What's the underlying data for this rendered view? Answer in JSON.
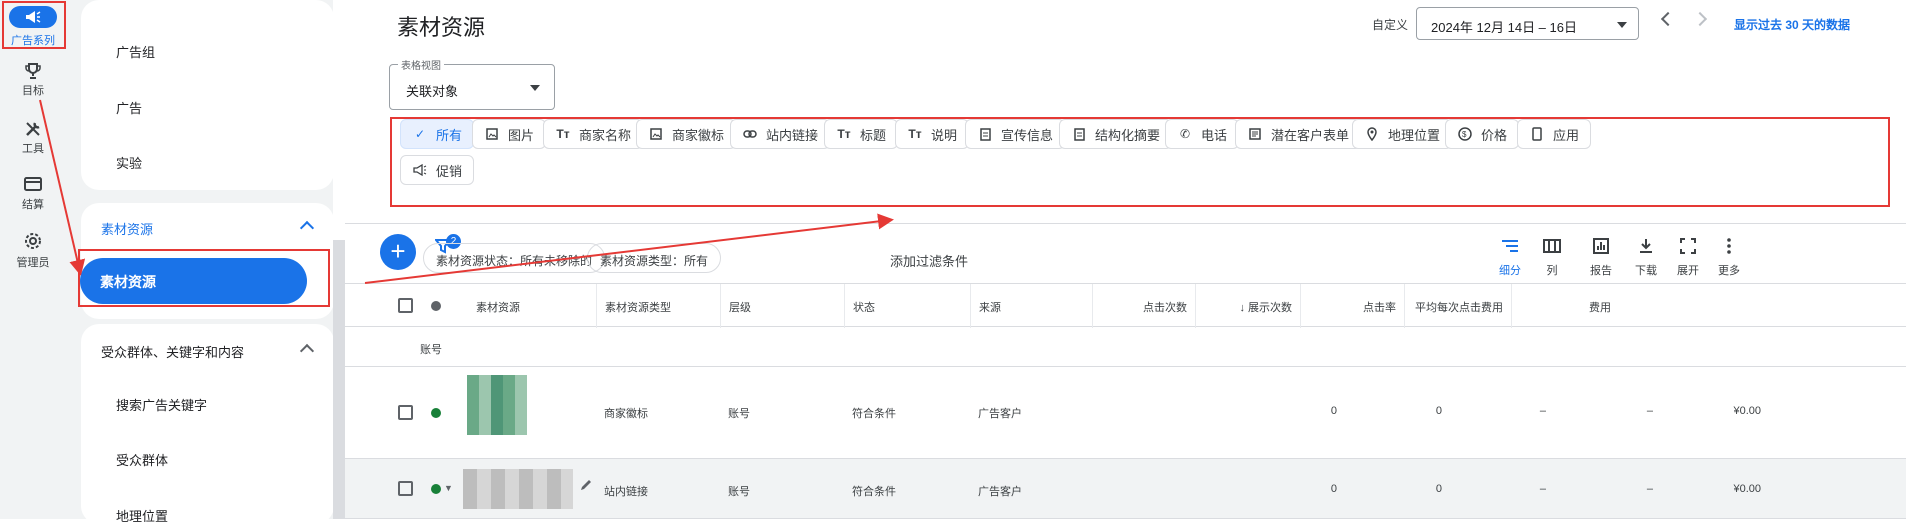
{
  "rail": [
    {
      "label": "广告系列",
      "icon": "megaphone-icon"
    },
    {
      "label": "目标",
      "icon": "trophy-icon"
    },
    {
      "label": "工具",
      "icon": "tools-icon"
    },
    {
      "label": "结算",
      "icon": "credit-card-icon"
    },
    {
      "label": "管理员",
      "icon": "gear-icon"
    }
  ],
  "sidebar": {
    "top_items": [
      "广告组",
      "广告",
      "实验"
    ],
    "assets_section": "素材资源",
    "assets_selected": "素材资源",
    "audience_section": "受众群体、关键字和内容",
    "audience_items": [
      "搜索广告关键字",
      "受众群体",
      "地理位置"
    ]
  },
  "header": {
    "title": "素材资源",
    "date_prefix": "自定义",
    "date_range": "2024年 12月 14日 – 16日",
    "show_30": "显示过去 30 天的数据"
  },
  "view_select": {
    "legend": "表格视图",
    "value": "关联对象"
  },
  "asset_types": [
    {
      "label": "所有",
      "icon": "check-icon",
      "selected": true
    },
    {
      "label": "图片",
      "icon": "image-icon"
    },
    {
      "label": "商家名称",
      "icon": "text-icon"
    },
    {
      "label": "商家徽标",
      "icon": "image-icon"
    },
    {
      "label": "站内链接",
      "icon": "link-icon"
    },
    {
      "label": "标题",
      "icon": "text-icon"
    },
    {
      "label": "说明",
      "icon": "text-icon"
    },
    {
      "label": "宣传信息",
      "icon": "document-icon"
    },
    {
      "label": "结构化摘要",
      "icon": "document-icon"
    },
    {
      "label": "电话",
      "icon": "phone-icon"
    },
    {
      "label": "潜在客户表单",
      "icon": "form-icon"
    },
    {
      "label": "地理位置",
      "icon": "location-pin-icon"
    },
    {
      "label": "价格",
      "icon": "price-icon"
    },
    {
      "label": "应用",
      "icon": "mobile-icon"
    },
    {
      "label": "促销",
      "icon": "megaphone-icon"
    }
  ],
  "filters": {
    "badge": "2",
    "chips": [
      "素材资源状态：所有未移除的",
      "素材资源类型：所有"
    ],
    "add": "添加过滤条件"
  },
  "toolbar": [
    "细分",
    "列",
    "报告",
    "下载",
    "展开",
    "更多"
  ],
  "table": {
    "headers": [
      "素材资源",
      "素材资源类型",
      "层级",
      "状态",
      "来源",
      "点击次数",
      "展示次数",
      "点击率",
      "平均每次点击费用",
      "费用"
    ],
    "group_label": "账号",
    "rows": [
      {
        "type": "商家徽标",
        "level": "账号",
        "status": "符合条件",
        "source": "广告客户",
        "clicks": "0",
        "impr": "0",
        "ctr": "–",
        "cpc": "–",
        "cost": "¥0.00"
      },
      {
        "type": "站内链接",
        "level": "账号",
        "status": "符合条件",
        "source": "广告客户",
        "clicks": "0",
        "impr": "0",
        "ctr": "–",
        "cpc": "–",
        "cost": "¥0.00"
      }
    ]
  },
  "colors": {
    "accent": "#1a73e8",
    "annotation": "#e53935",
    "status_green": "#188038"
  }
}
